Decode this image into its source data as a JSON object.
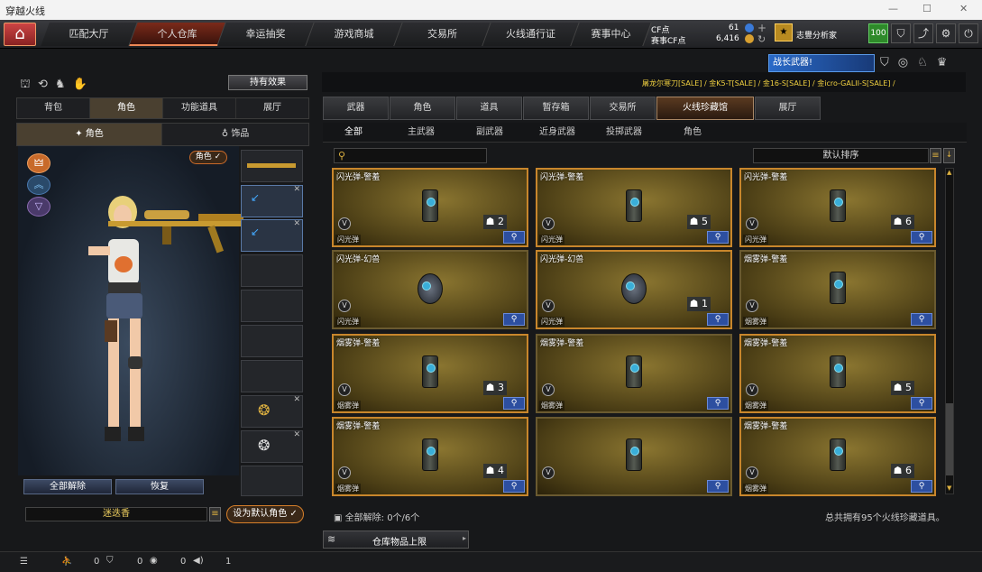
{
  "window": {
    "title": "穿越火线"
  },
  "topnav": {
    "tabs": [
      "匹配大厅",
      "个人仓库",
      "幸运抽奖",
      "游戏商城",
      "交易所",
      "火线通行证",
      "赛事中心"
    ],
    "active": 1
  },
  "account": {
    "cf_label": "CF点",
    "cf_value": "61",
    "event_label": "赛事CF点",
    "event_value": "6,416",
    "rank_name": "志豐分析家",
    "level": "100"
  },
  "left": {
    "tabs": [
      "背包",
      "角色",
      "功能道具",
      "展厅"
    ],
    "subtabs": [
      "角色",
      "饰品"
    ],
    "effect_button": "持有效果",
    "role_badge": "角色 ✓",
    "btn_unequip_all": "全部解除",
    "btn_restore": "恢复",
    "char_name": "迷迭香",
    "btn_set_default": "设为默认角色 ✓"
  },
  "banner": {
    "text": "战长武器!",
    "ticker": "屠龙尔寒刀[SALE] / 金K5-T[SALE] / 金16-S[SALE] / 金icro-GALII-S[SALE] /"
  },
  "right": {
    "tabs": [
      "武器",
      "角色",
      "道具",
      "暂存箱",
      "交易所",
      "火线珍藏馆",
      "展厅"
    ],
    "active_tab": 5,
    "subtabs": [
      "全部",
      "主武器",
      "副武器",
      "近身武器",
      "投掷武器",
      "角色"
    ],
    "search_placeholder": "",
    "sort_label": "默认排序",
    "items": [
      {
        "name": "闪光弹-警羞",
        "cat": "闪光弹",
        "count": "2",
        "shape": "can",
        "hl": true
      },
      {
        "name": "闪光弹-警羞",
        "cat": "闪光弹",
        "count": "5",
        "shape": "can",
        "hl": true
      },
      {
        "name": "闪光弹-警羞",
        "cat": "闪光弹",
        "count": "6",
        "shape": "can",
        "hl": true
      },
      {
        "name": "闪光弹-幻兽",
        "cat": "闪光弹",
        "count": "",
        "shape": "round",
        "hl": false
      },
      {
        "name": "闪光弹-幻兽",
        "cat": "闪光弹",
        "count": "1",
        "shape": "round",
        "hl": true
      },
      {
        "name": "烟雾弹-警羞",
        "cat": "烟雾弹",
        "count": "",
        "shape": "can",
        "hl": false
      },
      {
        "name": "烟雾弹-警羞",
        "cat": "烟雾弹",
        "count": "3",
        "shape": "can",
        "hl": true
      },
      {
        "name": "烟雾弹-警羞",
        "cat": "烟雾弹",
        "count": "",
        "shape": "can",
        "hl": false
      },
      {
        "name": "烟雾弹-警羞",
        "cat": "烟雾弹",
        "count": "5",
        "shape": "can",
        "hl": true
      },
      {
        "name": "烟雾弹-警羞",
        "cat": "烟雾弹",
        "count": "4",
        "shape": "can",
        "hl": true
      },
      {
        "name": "",
        "cat": "",
        "count": "",
        "shape": "can",
        "hl": false
      },
      {
        "name": "烟雾弹-警羞",
        "cat": "烟雾弹",
        "count": "6",
        "shape": "can",
        "hl": true
      }
    ],
    "footer_unequip": "全部解除: 0个/6个",
    "footer_total": "总共拥有95个火线珍藏道具。",
    "capacity_btn": "仓库物品上限"
  },
  "statusbar": {
    "v1": "0",
    "v2": "0",
    "v3": "0",
    "v4": "1"
  }
}
